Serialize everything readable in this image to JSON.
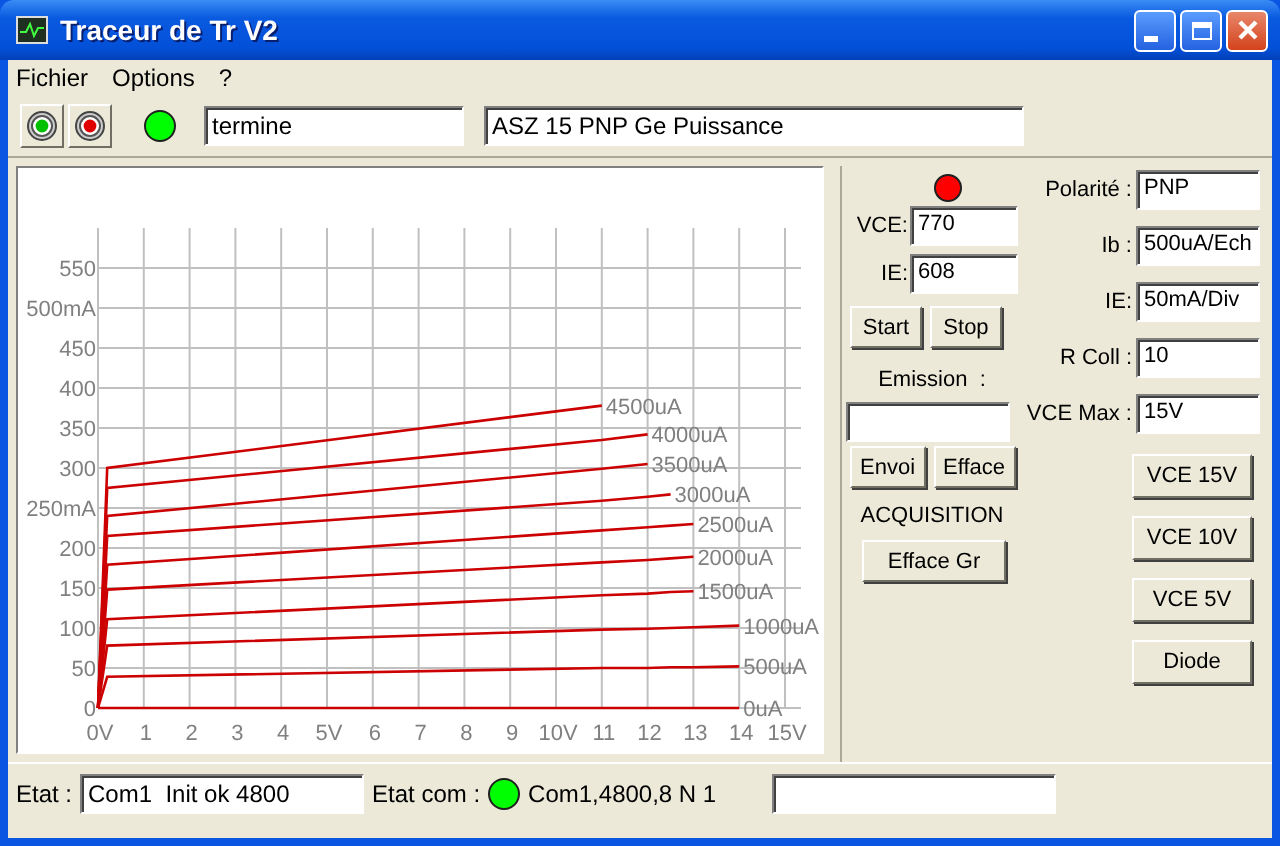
{
  "window": {
    "title": "Traceur de Tr V2"
  },
  "menu": [
    "Fichier",
    "Options",
    "?"
  ],
  "toolbar": {
    "buttons": [
      {
        "color": "#00c000"
      },
      {
        "color": "#e00000"
      }
    ],
    "indicator": {
      "color": "#00ff00"
    },
    "status_field": "termine",
    "device_field": "ASZ 15 PNP Ge Puissance"
  },
  "chart": {
    "chart_data": {
      "type": "line",
      "grid": true,
      "x": [
        0,
        0.2,
        11,
        12,
        12.5,
        13,
        14
      ],
      "xlim": [
        0,
        15
      ],
      "ylim": [
        0,
        550
      ],
      "xticks": [
        {
          "value": 0,
          "label": "0V"
        },
        1,
        2,
        3,
        4,
        {
          "value": 5,
          "label": "5V"
        },
        6,
        7,
        8,
        9,
        {
          "value": 10,
          "label": "10V"
        },
        11,
        12,
        13,
        14,
        {
          "value": 15,
          "label": "15V"
        }
      ],
      "yticks": [
        0,
        50,
        100,
        150,
        200,
        {
          "value": 250,
          "label": "250mA"
        },
        300,
        350,
        400,
        450,
        {
          "value": 500,
          "label": "500mA"
        },
        550
      ],
      "series": [
        {
          "name": "4500uA",
          "color": "#cc0000",
          "values": [
            0,
            300,
            378,
            null,
            null,
            null,
            null
          ]
        },
        {
          "name": "4000uA",
          "color": "#cc0000",
          "values": [
            0,
            275,
            335,
            342,
            null,
            null,
            null
          ]
        },
        {
          "name": "3500uA",
          "color": "#cc0000",
          "values": [
            0,
            240,
            299,
            305,
            null,
            null,
            null
          ]
        },
        {
          "name": "3000uA",
          "color": "#cc0000",
          "values": [
            0,
            215,
            259,
            264,
            267,
            null,
            null
          ]
        },
        {
          "name": "2500uA",
          "color": "#cc0000",
          "values": [
            0,
            179,
            222,
            226,
            228,
            230,
            null
          ]
        },
        {
          "name": "2000uA",
          "color": "#cc0000",
          "values": [
            0,
            148,
            182,
            185,
            187,
            189,
            null
          ]
        },
        {
          "name": "1500uA",
          "color": "#cc0000",
          "values": [
            0,
            111,
            141,
            143,
            145,
            146,
            null
          ]
        },
        {
          "name": "1000uA",
          "color": "#cc0000",
          "values": [
            0,
            78,
            98,
            99,
            100,
            101,
            103
          ]
        },
        {
          "name": "500uA",
          "color": "#cc0000",
          "values": [
            0,
            39,
            50,
            50,
            51,
            51,
            52
          ]
        },
        {
          "name": "0uA",
          "color": "#cc0000",
          "values": [
            0,
            0,
            0,
            0,
            0,
            0,
            0
          ]
        }
      ]
    }
  },
  "controls": {
    "indicator": {
      "color": "#ff0000"
    },
    "fields": [
      {
        "label": "VCE:",
        "value": "770"
      },
      {
        "label": "IE:",
        "value": "608"
      }
    ],
    "run_buttons": [
      "Start",
      "Stop"
    ],
    "emission": {
      "label": "Emission  :"
    },
    "send_buttons": [
      "Envoi",
      "Efface"
    ],
    "acquisition": {
      "label": "ACQUISITION",
      "button": "Efface Gr"
    }
  },
  "settings": [
    {
      "label": "Polarité :",
      "value": "PNP"
    },
    {
      "label": "Ib :",
      "value": "500uA/Ech"
    },
    {
      "label": "IE:",
      "value": "50mA/Div"
    },
    {
      "label": "R Coll :",
      "value": "10"
    },
    {
      "label": "VCE Max :",
      "value": "15V"
    }
  ],
  "range_buttons": [
    "VCE 15V",
    "VCE 10V",
    "VCE 5V",
    "Diode"
  ],
  "status_bar": {
    "etat_label": "Etat :",
    "etat_value": "Com1  Init ok 4800",
    "com_label": "Etat com :",
    "com_indicator": {
      "color": "#00ff00"
    },
    "com_value": "Com1,4800,8 N 1"
  }
}
